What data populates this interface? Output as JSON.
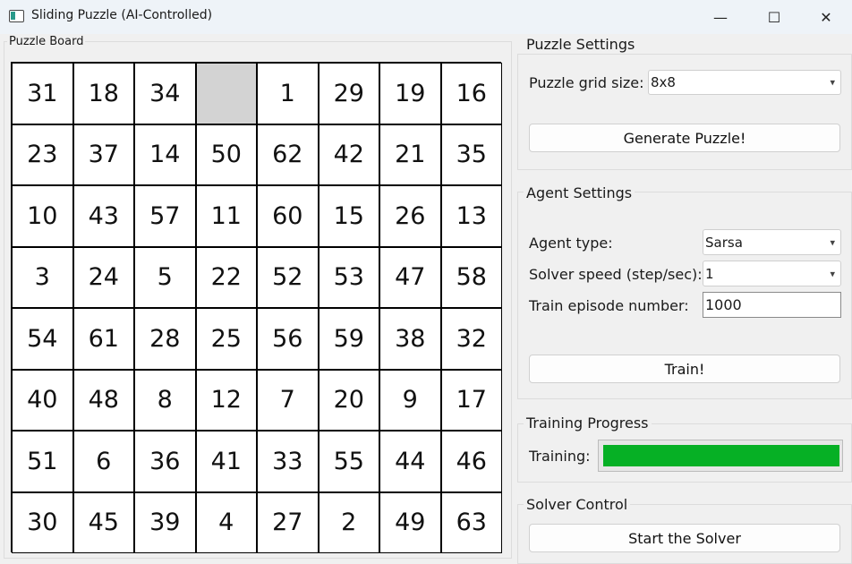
{
  "window": {
    "title": "Sliding Puzzle (AI-Controlled)",
    "minimize_glyph": "—",
    "maximize_glyph": "☐",
    "close_glyph": "✕"
  },
  "board": {
    "label": "Puzzle Board",
    "tiles": [
      [
        "31",
        "18",
        "34",
        "",
        "1",
        "29",
        "19",
        "16"
      ],
      [
        "23",
        "37",
        "14",
        "50",
        "62",
        "42",
        "21",
        "35"
      ],
      [
        "10",
        "43",
        "57",
        "11",
        "60",
        "15",
        "26",
        "13"
      ],
      [
        "3",
        "24",
        "5",
        "22",
        "52",
        "53",
        "47",
        "58"
      ],
      [
        "54",
        "61",
        "28",
        "25",
        "56",
        "59",
        "38",
        "32"
      ],
      [
        "40",
        "48",
        "8",
        "12",
        "7",
        "20",
        "9",
        "17"
      ],
      [
        "51",
        "6",
        "36",
        "41",
        "33",
        "55",
        "44",
        "46"
      ],
      [
        "30",
        "45",
        "39",
        "4",
        "27",
        "2",
        "49",
        "63"
      ]
    ]
  },
  "puzzle_settings": {
    "title": "Puzzle Settings",
    "grid_size_label": "Puzzle grid size:",
    "grid_size_value": "8x8",
    "generate_label": "Generate Puzzle!"
  },
  "agent_settings": {
    "title": "Agent Settings",
    "agent_type_label": "Agent type:",
    "agent_type_value": "Sarsa",
    "speed_label": "Solver speed (step/sec):",
    "speed_value": "1",
    "episodes_label": "Train episode number:",
    "episodes_value": "1000",
    "train_label": "Train!"
  },
  "training_progress": {
    "title": "Training Progress",
    "label": "Training:",
    "progress_fraction": 1.0,
    "bar_color": "#06b025"
  },
  "solver_control": {
    "title": "Solver Control",
    "start_label": "Start the Solver"
  }
}
